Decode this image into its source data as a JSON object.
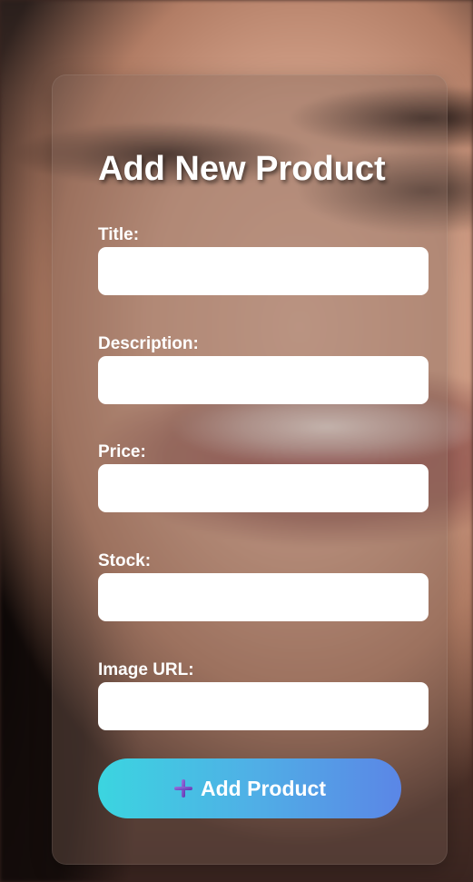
{
  "form": {
    "title": "Add New Product",
    "fields": [
      {
        "label": "Title:",
        "value": ""
      },
      {
        "label": "Description:",
        "value": ""
      },
      {
        "label": "Price:",
        "value": ""
      },
      {
        "label": "Stock:",
        "value": ""
      },
      {
        "label": "Image URL:",
        "value": ""
      }
    ],
    "submit": {
      "icon": "plus-icon",
      "label": "Add Product",
      "icon_color": "#7b4fc9",
      "gradient_start": "#3bd5e0",
      "gradient_end": "#5b86e6"
    }
  }
}
